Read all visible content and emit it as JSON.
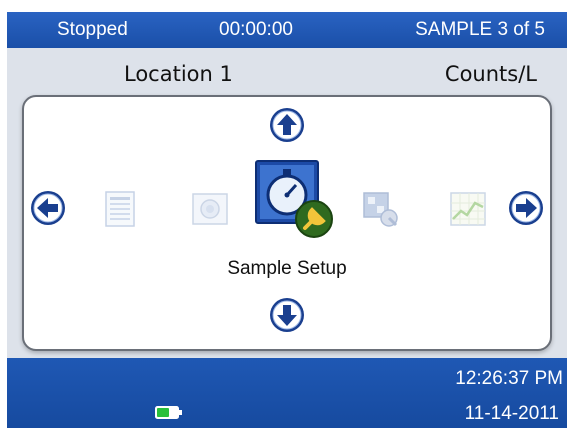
{
  "status_bar": {
    "state": "Stopped",
    "elapsed": "00:00:00",
    "sample": "SAMPLE 3 of 5"
  },
  "header": {
    "location": "Location 1",
    "units": "Counts/L"
  },
  "carousel": {
    "selected_label": "Sample Setup",
    "items": [
      "list-icon",
      "photo-icon",
      "sample-setup-icon",
      "tools-icon",
      "chart-icon"
    ]
  },
  "footer": {
    "time": "12:26:37 PM",
    "date": "11-14-2011"
  },
  "colors": {
    "bar_blue": "#1f58b4",
    "arrow_blue": "#1a3f8f",
    "battery_green": "#29c03a"
  }
}
